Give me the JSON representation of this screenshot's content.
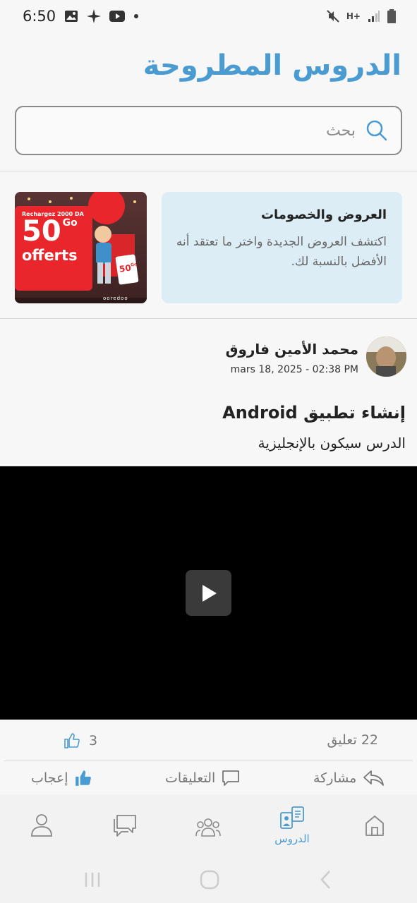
{
  "status_bar": {
    "time": "6:50",
    "network": "H+"
  },
  "header": {
    "title": "الدروس المطروحة"
  },
  "search": {
    "placeholder": "بحث"
  },
  "promo": {
    "title": "العروض والخصومات",
    "description": "اكتشف العروض الجديدة واختر ما تعتقد أنه الأفضل بالنسبة لك.",
    "image": {
      "headline": "Rechargez 2000 DA",
      "amount": "50",
      "unit": "Go",
      "word": "offerts",
      "tag_amount": "50",
      "tag_unit": "Go",
      "brand": "ooredoo"
    }
  },
  "post": {
    "author": "محمد الأمين فاروق",
    "date": "mars 18, 2025 - 02:38 PM",
    "title": "إنشاء تطبيق Android",
    "subtitle": "الدرس سيكون بالإنجليزية"
  },
  "stats": {
    "likes": "3",
    "comments": "22 تعليق"
  },
  "actions": {
    "like": "إعجاب",
    "comments": "التعليقات",
    "share": "مشاركة"
  },
  "bottom_nav": {
    "items": [
      {
        "icon": "home-icon",
        "label": ""
      },
      {
        "icon": "lessons-icon",
        "label": "الدروس"
      },
      {
        "icon": "group-icon",
        "label": ""
      },
      {
        "icon": "chat-icon",
        "label": ""
      },
      {
        "icon": "profile-icon",
        "label": ""
      }
    ],
    "active_index": 1
  },
  "colors": {
    "accent": "#4a9bd1",
    "promo_bg": "#dcedf6"
  }
}
